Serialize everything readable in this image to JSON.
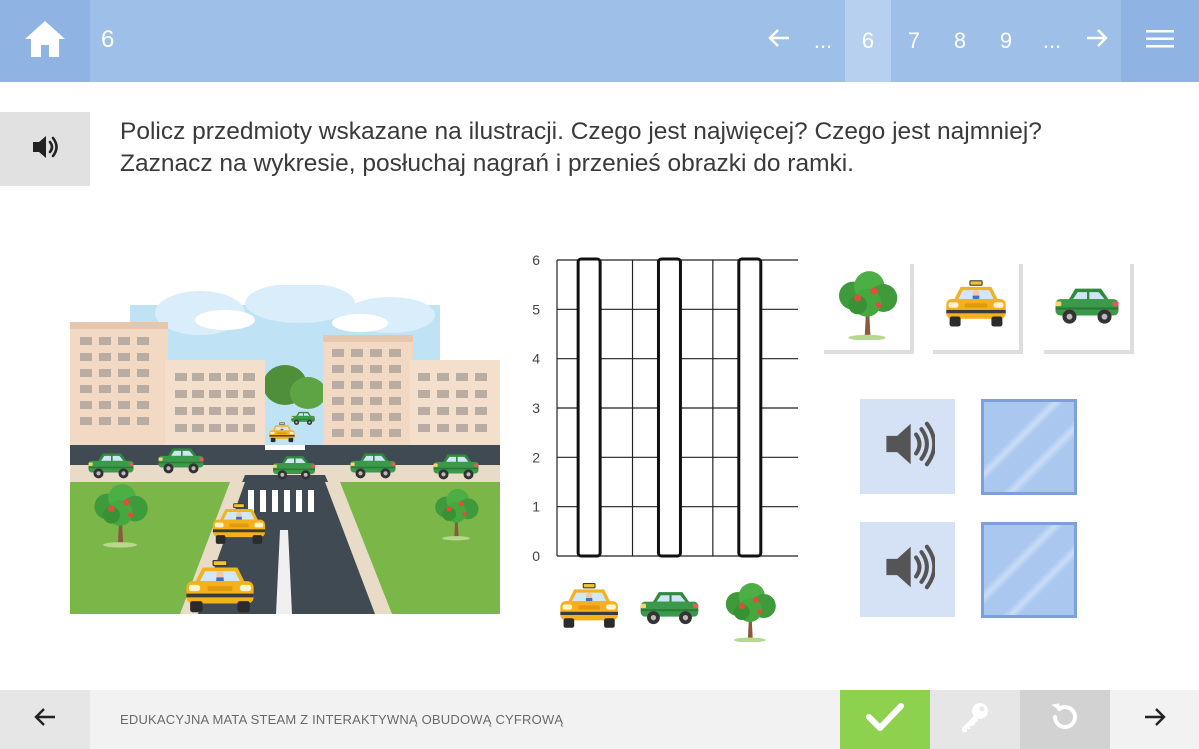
{
  "header": {
    "current_page": "6",
    "pagination": {
      "prev_arrow": "←",
      "ellipsis_left": "...",
      "pages": [
        "6",
        "7",
        "8",
        "9"
      ],
      "current": "6",
      "ellipsis_right": "...",
      "next_arrow": "→"
    }
  },
  "instruction": {
    "line1": "Policz przedmioty wskazane na ilustracji. Czego jest najwięcej? Czego jest najmniej?",
    "line2": "Zaznacz na wykresie, posłuchaj nagrań i przenieś obrazki do ramki."
  },
  "chart_data": {
    "type": "bar",
    "categories": [
      "taxi",
      "green car",
      "tree"
    ],
    "values": [
      0,
      0,
      0
    ],
    "max": 6,
    "ylim": [
      0,
      6
    ],
    "yticks": [
      "0",
      "1",
      "2",
      "3",
      "4",
      "5",
      "6"
    ],
    "grid": true
  },
  "tiles": [
    {
      "icon": "tree-icon"
    },
    {
      "icon": "taxi-icon"
    },
    {
      "icon": "green-car-icon"
    }
  ],
  "footer": {
    "title": "EDUKACYJNA MATA STEAM Z INTERAKTYWNĄ OBUDOWĄ CYFROWĄ"
  },
  "colors": {
    "topbar": "#9ebfe8",
    "accent_check": "#8ed14e",
    "drop_zone": "#a9c7ef"
  }
}
